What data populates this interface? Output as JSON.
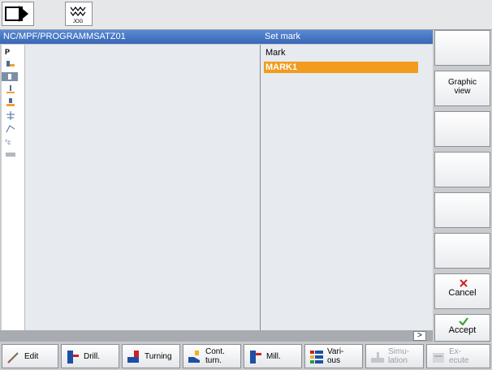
{
  "header": {
    "path": "NC/MPF/PROGRAMMSATZ01",
    "panel_title": "Set mark"
  },
  "mark_panel": {
    "label": "Mark",
    "items": [
      "MARK1"
    ]
  },
  "status": {
    "more": ">"
  },
  "right_softkeys": [
    {
      "label": ""
    },
    {
      "label": "Graphic view"
    },
    {
      "label": ""
    },
    {
      "label": ""
    },
    {
      "label": ""
    },
    {
      "label": ""
    },
    {
      "label": "Cancel"
    },
    {
      "label": "Accept"
    }
  ],
  "bottom_softkeys": [
    {
      "label": "Edit"
    },
    {
      "label": "Drill."
    },
    {
      "label": "Turning"
    },
    {
      "label": "Cont. turn."
    },
    {
      "label": "Mill."
    },
    {
      "label": "Vari- ous"
    },
    {
      "label": "Simu- lation"
    },
    {
      "label": "Ex- ecute"
    }
  ],
  "sidebar": {
    "first_glyph": "P"
  },
  "colors": {
    "header_blue": "#3767b6",
    "highlight_orange": "#f29b1d"
  }
}
